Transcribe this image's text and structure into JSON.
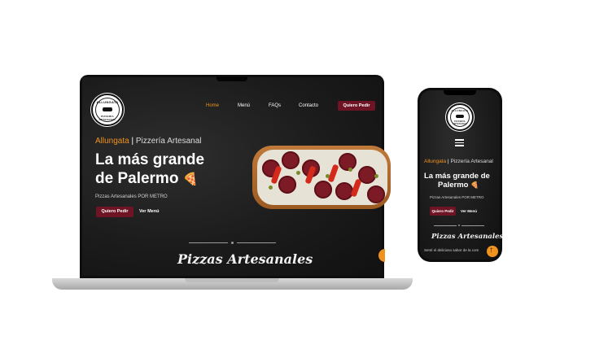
{
  "desktop": {
    "logo": {
      "text_top": "ALLUNGATA",
      "text_bottom": "PIZZERÍA ARTESANAL"
    },
    "nav": [
      {
        "label": "Home",
        "active": true
      },
      {
        "label": "Menú",
        "active": false
      },
      {
        "label": "FAQs",
        "active": false
      },
      {
        "label": "Contacto",
        "active": false
      }
    ],
    "cta": "Quiero Pedir",
    "hero": {
      "brand": "Allungata",
      "separator": "|",
      "subtitle": "Pizzería Artesanal",
      "headline_line1": "La más grande",
      "headline_line2": "de Palermo",
      "emoji": "🍕",
      "tagline": "Pizzas Artesanales POR METRO",
      "primary_button": "Quiero Pedir",
      "secondary_button": "Ver Menú"
    },
    "section_title": "Pizzas Artesanales"
  },
  "mobile": {
    "logo": {
      "text_top": "ALLUNGATA",
      "text_bottom": "PIZZERÍA ARTESANAL"
    },
    "menu_icon": "hamburger-icon",
    "hero": {
      "brand": "Allungata",
      "separator": "|",
      "subtitle": "Pizzería Artesanal",
      "headline_line1": "La más grande de",
      "headline_line2": "Palermo",
      "emoji": "🍕",
      "tagline": "Pizzas Artesanales POR METRO",
      "primary_button": "Quiero Pedir",
      "secondary_button": "Ver Menú"
    },
    "section_title": "Pizzas Artesanales",
    "intro_text": "Sentí el delicioso sabor de la com"
  },
  "colors": {
    "accent": "#f0931e",
    "button": "#6e1424",
    "background": "#1b1b1b"
  }
}
